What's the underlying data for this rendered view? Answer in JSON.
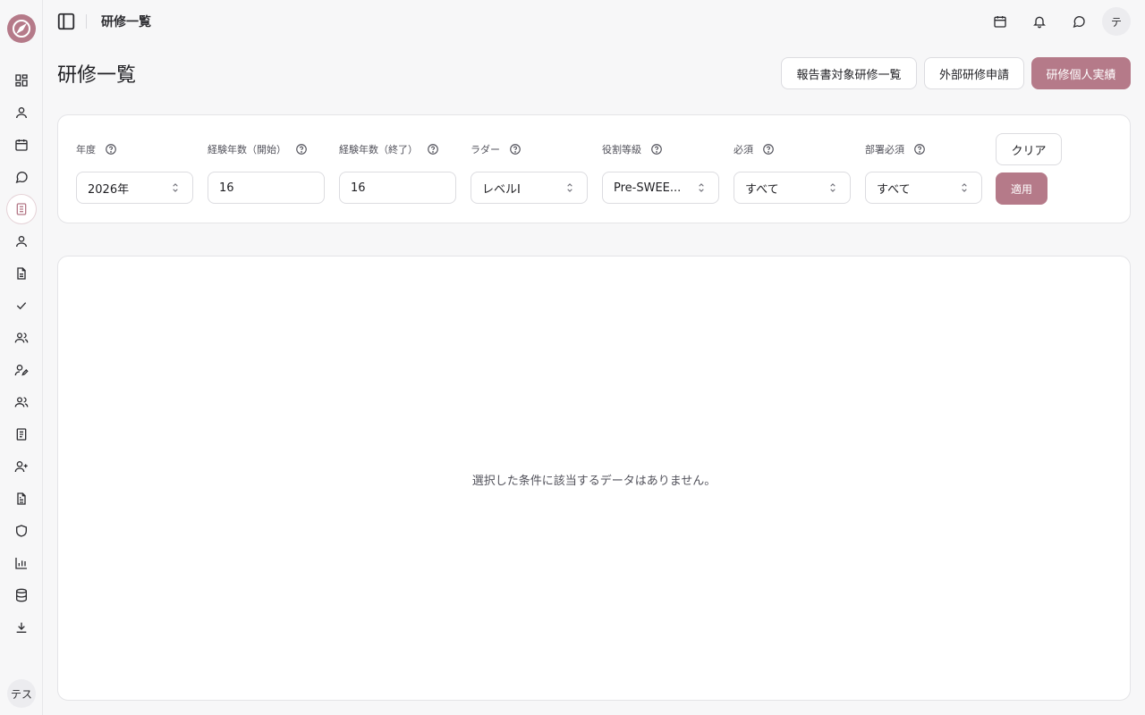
{
  "colors": {
    "accent": "#b57a89",
    "background": "#f7f7f8",
    "card": "#ffffff",
    "border": "#e4e4e7"
  },
  "header": {
    "title": "研修一覧",
    "icons": [
      "calendar-icon",
      "bell-icon",
      "message-icon"
    ],
    "avatar_text": "テ"
  },
  "sidebar": {
    "icons": [
      "dashboard-icon",
      "user-icon",
      "calendar-icon",
      "message-icon",
      "document-icon",
      "user-icon",
      "file-icon",
      "check-icon",
      "users-icon",
      "user-edit-icon",
      "users-icon",
      "book-icon",
      "user-plus-icon",
      "file-text-icon",
      "shield-icon",
      "bar-chart-icon",
      "database-icon",
      "download-icon"
    ],
    "active_index": 4,
    "user_avatar_text": "テス"
  },
  "page": {
    "title": "研修一覧",
    "actions": {
      "report_list": "報告書対象研修一覧",
      "external_apply": "外部研修申請",
      "personal_record": "研修個人実績"
    }
  },
  "filters": {
    "year": {
      "label": "年度",
      "value": "2026年"
    },
    "exp_start": {
      "label": "経験年数（開始）",
      "value": "16"
    },
    "exp_end": {
      "label": "経験年数（終了）",
      "value": "16"
    },
    "ladder": {
      "label": "ラダー",
      "value": "レベルI"
    },
    "role_grade": {
      "label": "役割等級",
      "value": "Pre-SWEE..."
    },
    "required": {
      "label": "必須",
      "value": "すべて"
    },
    "dept_required": {
      "label": "部署必須",
      "value": "すべて"
    },
    "clear_label": "クリア",
    "apply_label": "適用"
  },
  "results": {
    "empty_message": "選択した条件に該当するデータはありません。"
  }
}
